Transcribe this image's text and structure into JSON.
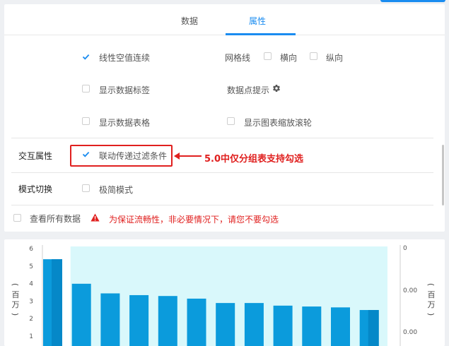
{
  "tabs": [
    {
      "label": "数据",
      "active": false
    },
    {
      "label": "属性",
      "active": true
    }
  ],
  "options": {
    "line_null_connect": {
      "label": "线性空值连续",
      "checked": true
    },
    "grid_label": "网格线",
    "grid_horizontal": {
      "label": "横向",
      "checked": false
    },
    "grid_vertical": {
      "label": "纵向",
      "checked": false
    },
    "show_data_labels": {
      "label": "显示数据标签",
      "checked": false
    },
    "data_point_tip": {
      "label": "数据点提示",
      "icon": "gear-icon"
    },
    "show_data_table": {
      "label": "显示数据表格",
      "checked": false
    },
    "show_zoom_wheel": {
      "label": "显示图表缩放滚轮",
      "checked": false
    }
  },
  "interaction": {
    "section_label": "交互属性",
    "linked_filter": {
      "label": "联动传递过滤条件",
      "checked": true
    }
  },
  "annotation": {
    "text": "5.0中仅分组表支持勾选",
    "color": "#e0201f"
  },
  "mode": {
    "section_label": "模式切换",
    "simple_mode": {
      "label": "极简模式",
      "checked": false
    }
  },
  "view_all": {
    "label": "查看所有数据",
    "checked": false
  },
  "warning": {
    "text": "为保证流畅性，非必要情况下，请您不要勾选",
    "icon": "warning-icon",
    "color": "#e0201f"
  },
  "colors": {
    "accent": "#1a8cf0",
    "bar": "#0b9bdc",
    "highlight": "#d9f8fb"
  },
  "chart_data": {
    "type": "bar",
    "left_ylabel": "（百万）",
    "right_ylabel": "（百万）",
    "left_ticks": [
      "6",
      "5",
      "4",
      "3",
      "2",
      "1"
    ],
    "left_ylim": [
      0,
      6
    ],
    "right_ticks": [
      "0",
      "0.00",
      "0.00"
    ],
    "values": [
      5.35,
      3.95,
      3.4,
      3.3,
      3.25,
      3.1,
      2.85,
      2.85,
      2.7,
      2.65,
      2.6,
      2.45
    ],
    "highlighted_range": [
      1,
      11
    ]
  }
}
